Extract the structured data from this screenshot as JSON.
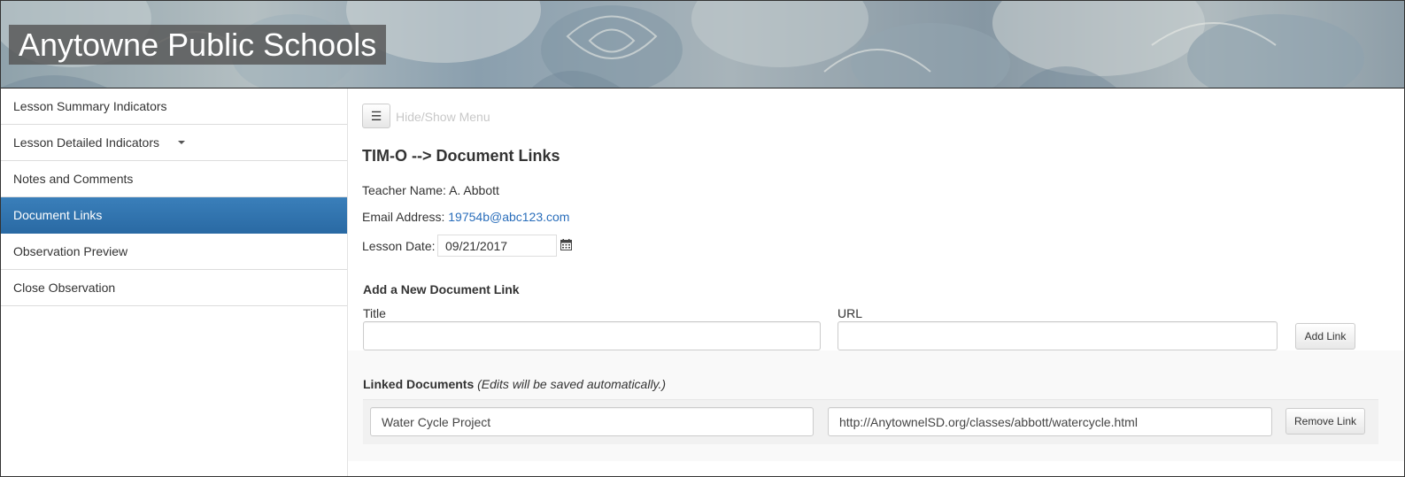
{
  "header": {
    "site_title": "Anytowne Public Schools"
  },
  "sidebar": {
    "items": [
      {
        "label": "Lesson Summary Indicators",
        "active": false
      },
      {
        "label": "Lesson Detailed Indicators",
        "active": false,
        "has_dropdown": true
      },
      {
        "label": "Notes and Comments",
        "active": false
      },
      {
        "label": "Document Links",
        "active": true
      },
      {
        "label": "Observation Preview",
        "active": false
      },
      {
        "label": "Close Observation",
        "active": false
      }
    ]
  },
  "toolbar": {
    "menu_icon": "hamburger-icon",
    "toggle_label": "Hide/Show Menu"
  },
  "main": {
    "heading": "TIM-O --> Document Links",
    "teacher_label": "Teacher Name:",
    "teacher_name": "A. Abbott",
    "email_label": "Email Address:",
    "email": "19754b@abc123.com",
    "date_label": "Lesson Date:",
    "lesson_date": "09/21/2017",
    "date_icon": "calendar-icon"
  },
  "add_link": {
    "heading": "Add a New Document Link",
    "title_label": "Title",
    "url_label": "URL",
    "title_value": "",
    "url_value": "",
    "button": "Add Link"
  },
  "linked_docs": {
    "heading": "Linked Documents",
    "hint": "(Edits will be saved automatically.)",
    "rows": [
      {
        "title": "Water Cycle Project",
        "url": "http://AnytownelSD.org/classes/abbott/watercycle.html",
        "button": "Remove Link"
      }
    ]
  },
  "colors": {
    "active_nav": "#2f73ae",
    "link": "#2a6ebb",
    "title_bg": "#555555"
  }
}
